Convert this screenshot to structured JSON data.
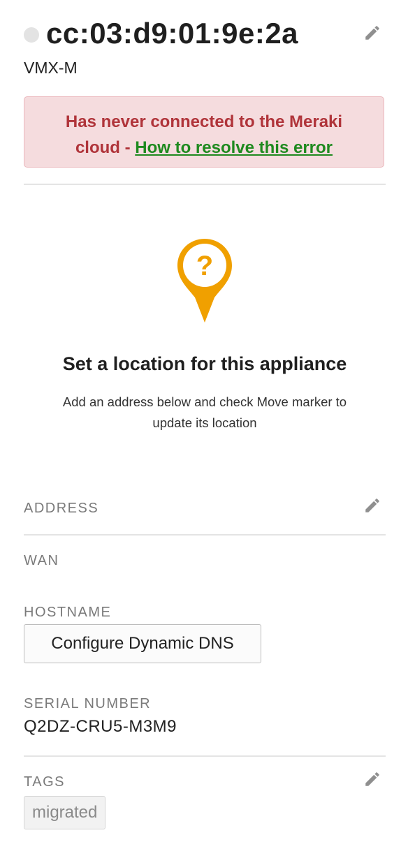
{
  "device": {
    "name": "cc:03:d9:01:9e:2a",
    "model": "VMX-M",
    "status_color": "#e3e3e3"
  },
  "error": {
    "message": "Has never connected to the Meraki cloud -",
    "link_text": "How to resolve this error"
  },
  "location": {
    "title": "Set a location for this appliance",
    "description": "Add an address below and check Move marker to update its location",
    "pin_symbol": "?",
    "pin_color": "#f0a000"
  },
  "fields": {
    "address_label": "ADDRESS",
    "wan_label": "WAN",
    "hostname_label": "HOSTNAME",
    "ddns_button": "Configure Dynamic DNS",
    "serial_label": "SERIAL NUMBER",
    "serial_value": "Q2DZ-CRU5-M3M9",
    "tags_label": "TAGS",
    "tags": [
      "migrated"
    ]
  },
  "icons": {
    "edit": "pencil-icon",
    "location": "map-pin-icon"
  },
  "colors": {
    "error_text": "#b0343a",
    "error_bg": "#f5dcde",
    "link": "#1f8a1f",
    "pin": "#f0a000"
  }
}
